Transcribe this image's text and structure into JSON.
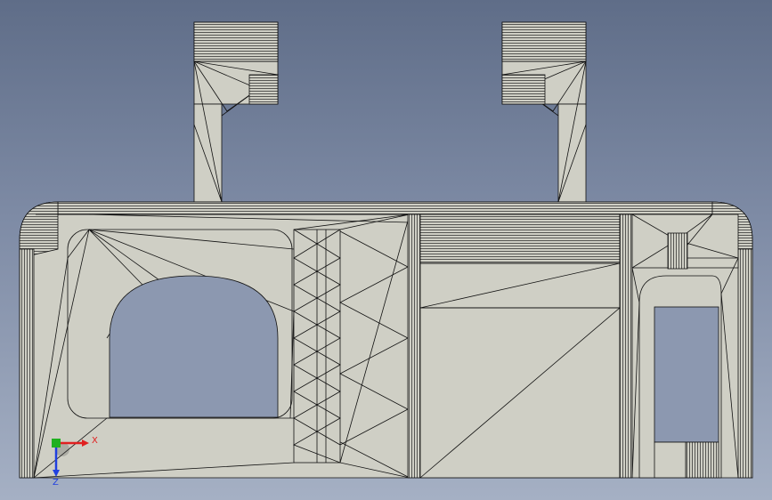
{
  "viewport": {
    "background_top": "#5f6d88",
    "background_bottom": "#a5b0c4",
    "model_fill": "#cfcfc5",
    "edge_color": "#111111"
  },
  "triad": {
    "x_label": "X",
    "z_label": "Z",
    "x_color": "#e02020",
    "y_color": "#20b020",
    "z_color": "#2040e0"
  }
}
